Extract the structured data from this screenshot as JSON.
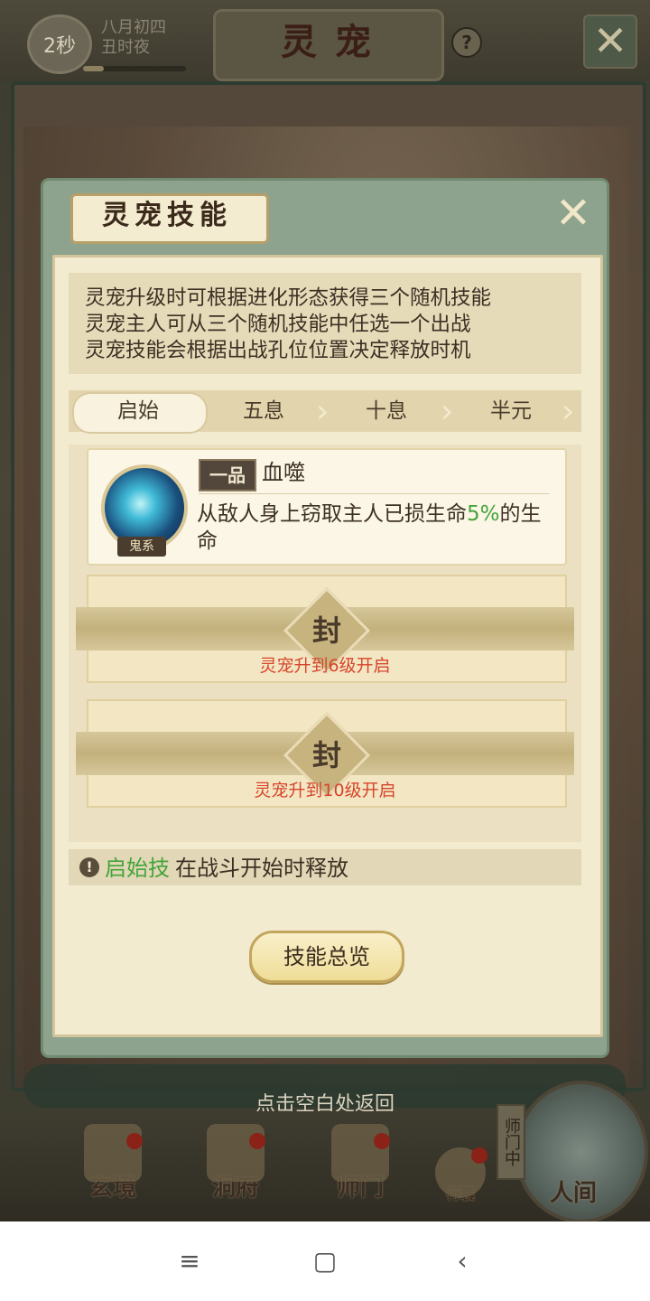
{
  "topbar": {
    "timer": "2秒",
    "date_line1": "八月初四",
    "date_line2": "丑时夜",
    "progress": 0.2,
    "title": "灵宠",
    "help_icon": "question-icon",
    "close_icon": "close-icon"
  },
  "modal": {
    "title": "灵宠技能",
    "close_icon": "close-icon",
    "description": [
      "灵宠升级时可根据进化形态获得三个随机技能",
      "灵宠主人可从三个随机技能中任选一个出战",
      "灵宠技能会根据出战孔位位置决定释放时机"
    ],
    "tabs": [
      {
        "label": "启始",
        "active": true
      },
      {
        "label": "五息",
        "active": false
      },
      {
        "label": "十息",
        "active": false
      },
      {
        "label": "半元",
        "active": false
      }
    ],
    "skill": {
      "grade": "一品",
      "name": "血噬",
      "type": "鬼系",
      "desc_pre": "从敌人身上窃取主人已损生命",
      "desc_pct": "5%",
      "desc_post": "的生命"
    },
    "locked_slots": [
      {
        "seal": "封",
        "text": "灵宠升到6级开启"
      },
      {
        "seal": "封",
        "text": "灵宠升到10级开启"
      }
    ],
    "note": {
      "icon": "exclamation-icon",
      "highlight": "启始技",
      "text": "在战斗开始时释放"
    },
    "overview_button": "技能总览"
  },
  "return_hint": "点击空白处返回",
  "dock": {
    "items": [
      {
        "label": "玄境"
      },
      {
        "label": "洞府"
      },
      {
        "label": "师门"
      },
      {
        "label": "行囊"
      },
      {
        "label": "人间"
      }
    ],
    "shimen_tag": "师门中"
  },
  "colors": {
    "accent_green": "#44a43c",
    "lock_red": "#d6452c",
    "panel_bg": "#f2ebd0",
    "modal_frame": "#8ea38d"
  }
}
